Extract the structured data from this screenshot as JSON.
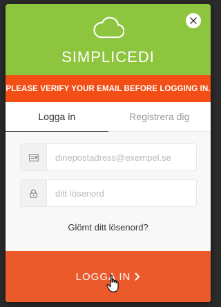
{
  "header": {
    "app_name": "SIMPLICEDI",
    "logo_icon": "cloud-icon",
    "close_icon": "close-icon",
    "background": "#8dc53e"
  },
  "banner": {
    "text": "PLEASE VERIFY YOUR EMAIL BEFORE LOGGING IN.",
    "background": "#f34e15"
  },
  "tabs": [
    {
      "label": "Logga in",
      "active": true
    },
    {
      "label": "Registrera dig",
      "active": false
    }
  ],
  "form": {
    "email": {
      "placeholder": "dinepostadress@exempel.se",
      "value": "",
      "icon": "email-card-icon"
    },
    "password": {
      "placeholder": "ditt lösenord",
      "value": "",
      "icon": "lock-icon"
    },
    "forgot_label": "Glömt ditt lösenord?"
  },
  "submit": {
    "label": "LOGGA IN",
    "icon": "chevron-right-icon",
    "background": "#eb5a2b"
  }
}
